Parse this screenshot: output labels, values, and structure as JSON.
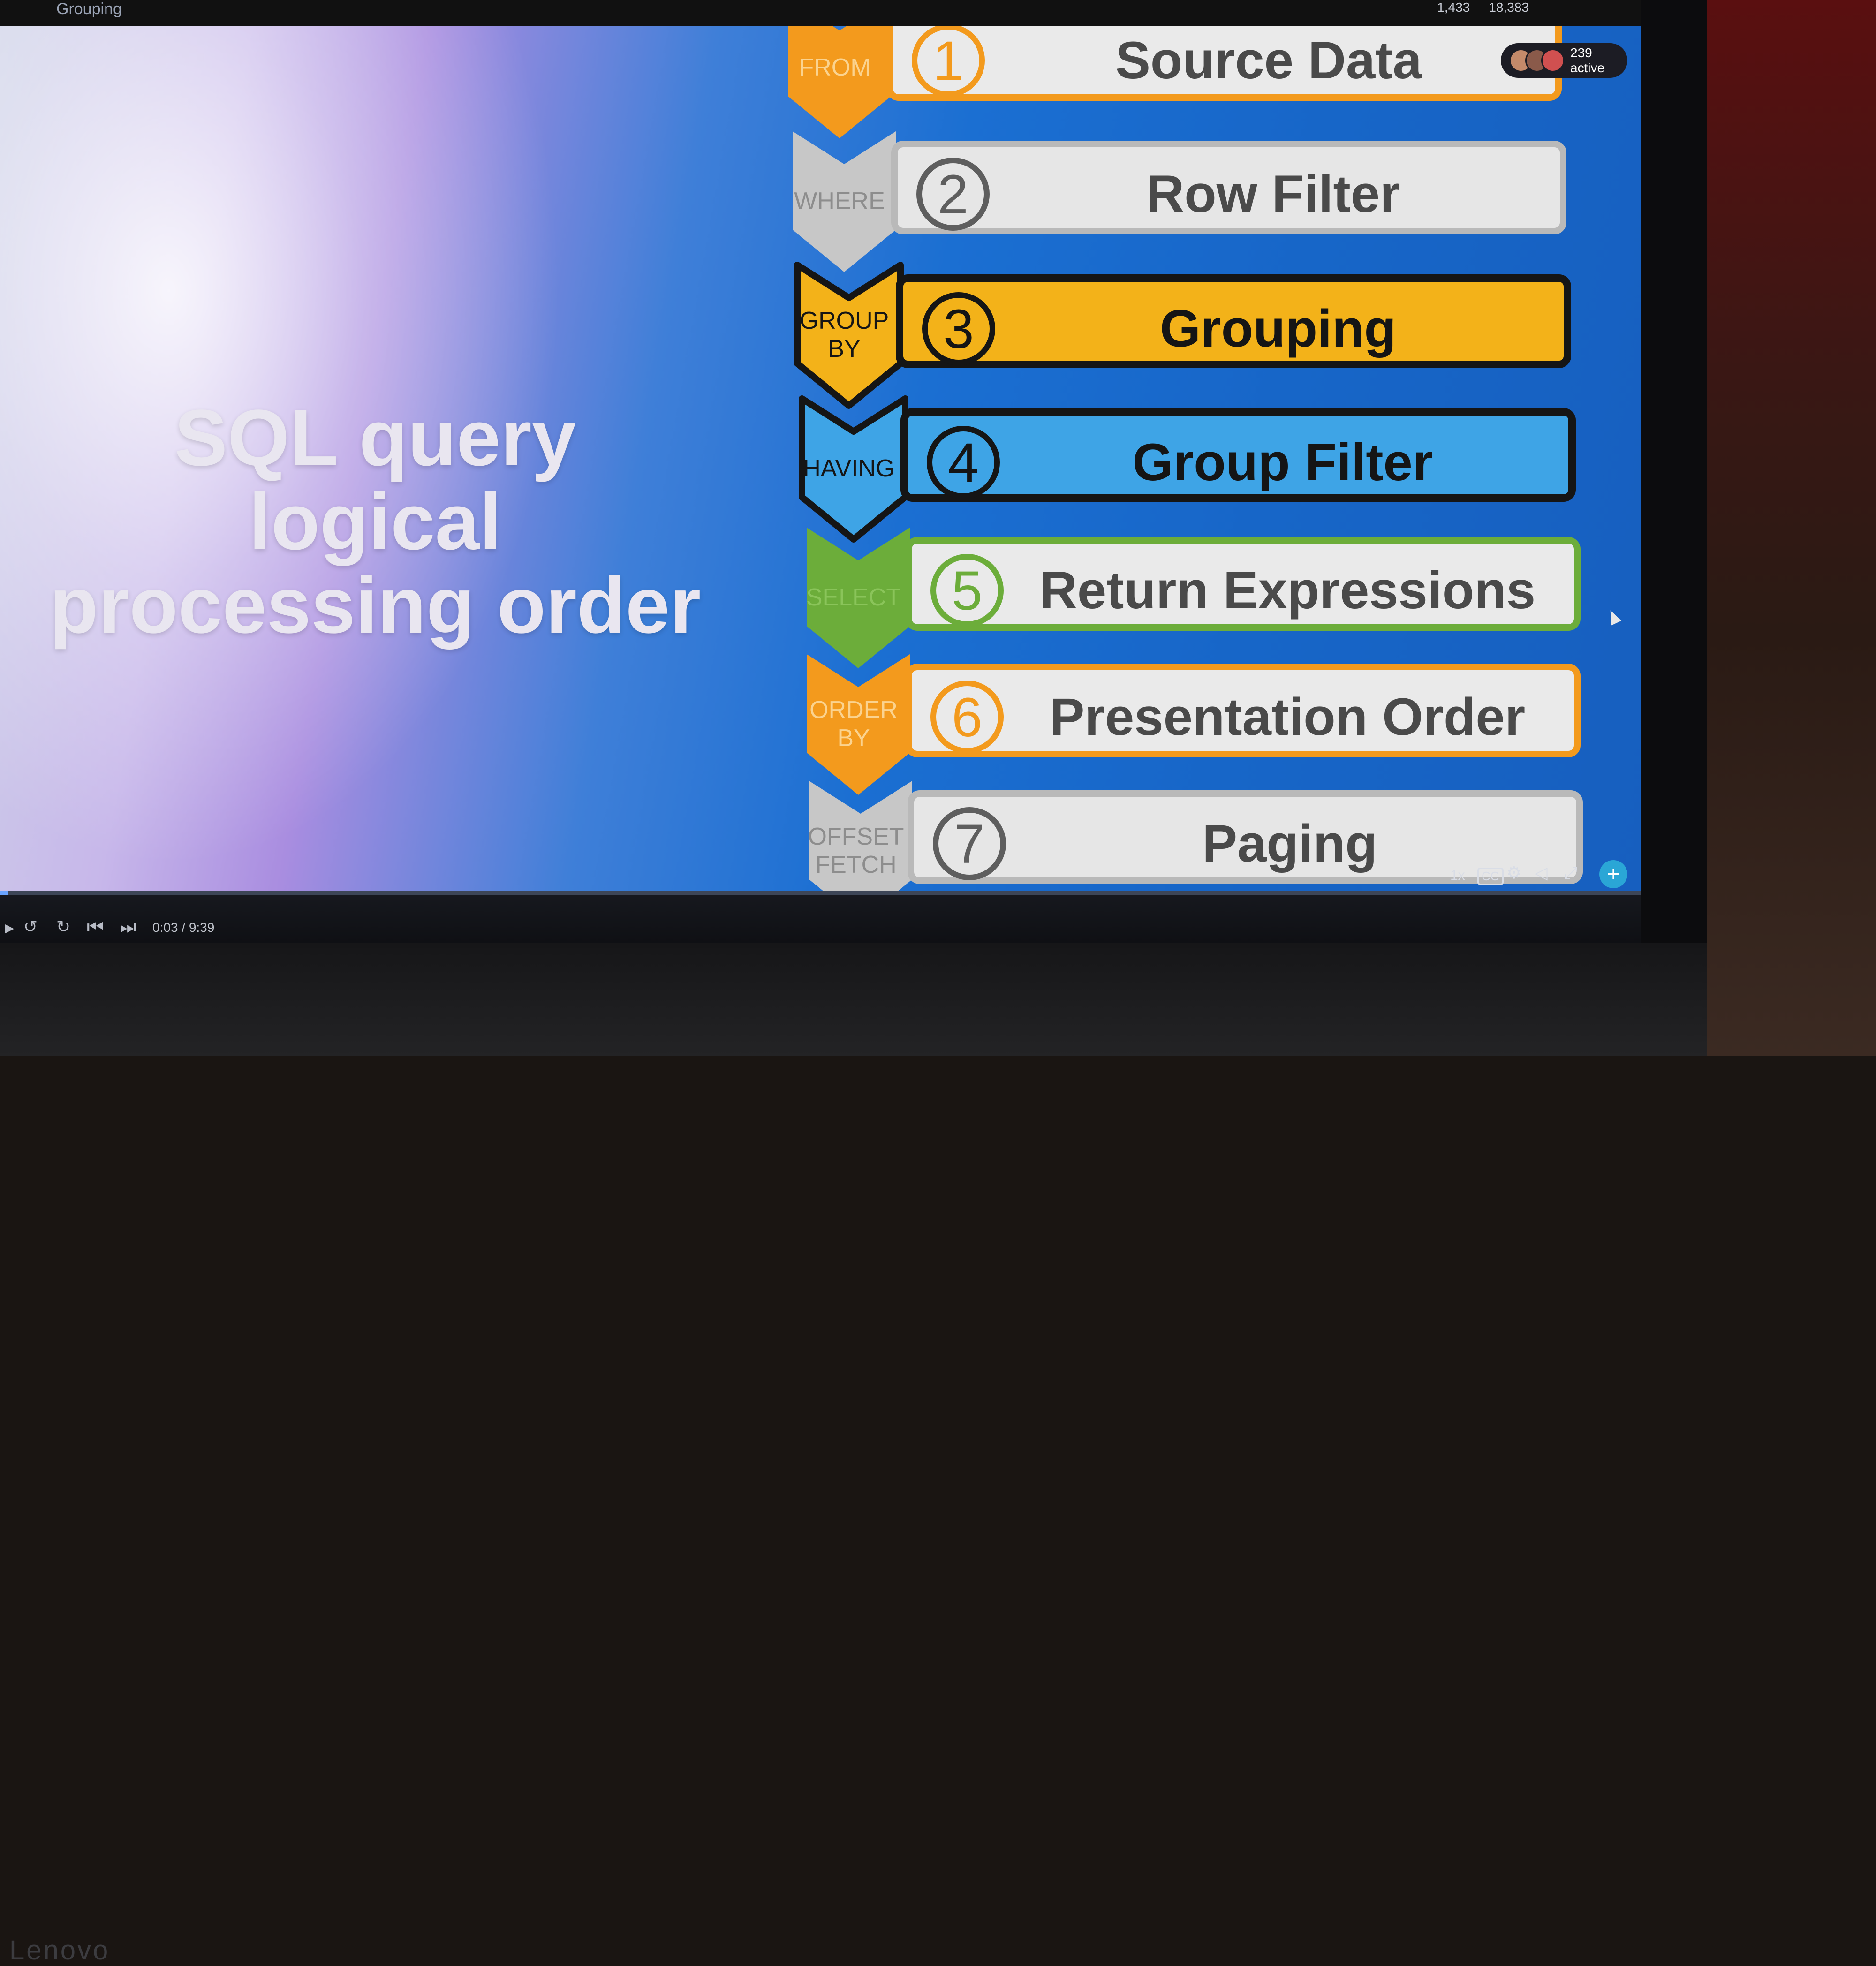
{
  "player": {
    "breadcrumb": "Grouping",
    "stats": [
      "1,433",
      "18,383"
    ],
    "active_viewers": "239 active",
    "time": "0:03 / 9:39",
    "speed": "1x",
    "cc": "CC",
    "progress_fraction": 0.005
  },
  "slide": {
    "title": "SQL query logical processing order",
    "steps": [
      {
        "number": "1",
        "clause": "FROM",
        "label": "Source Data",
        "theme": "orange"
      },
      {
        "number": "2",
        "clause": "WHERE",
        "label": "Row Filter",
        "theme": "gray"
      },
      {
        "number": "3",
        "clause": "GROUP BY",
        "label": "Grouping",
        "theme": "yellow"
      },
      {
        "number": "4",
        "clause": "HAVING",
        "label": "Group Filter",
        "theme": "blue"
      },
      {
        "number": "5",
        "clause": "SELECT",
        "label": "Return Expressions",
        "theme": "green"
      },
      {
        "number": "6",
        "clause": "ORDER BY",
        "label": "Presentation Order",
        "theme": "orange"
      },
      {
        "number": "7",
        "clause": "OFFSET FETCH",
        "label": "Paging",
        "theme": "gray"
      }
    ]
  },
  "theme_colors": {
    "orange": "#f39a1d",
    "gray": "#b9b9b9",
    "yellow": "#f3b219",
    "blue": "#3ea4e6",
    "green": "#6cad3a"
  },
  "hardware": {
    "brand": "Lenovo"
  }
}
